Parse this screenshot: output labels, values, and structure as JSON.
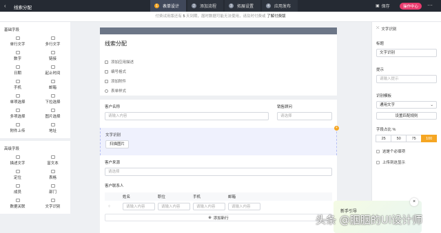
{
  "topbar": {
    "back": "‹",
    "title": "线索分配",
    "steps": [
      {
        "num": "1",
        "label": "表单设计"
      },
      {
        "num": "2",
        "label": "添加流程"
      },
      {
        "num": "3",
        "label": "拓展设置"
      },
      {
        "num": "4",
        "label": "应用发布"
      }
    ],
    "save": "保存",
    "upgrade": "操作中心",
    "more": "⋯"
  },
  "notice": {
    "pre": "付费试用版还有",
    "days": "5",
    "mid": "天到期，届时数据可能无法使用，请及时付费或",
    "link": "了解付费版"
  },
  "left": {
    "basic_title": "基础字段",
    "basic": [
      "单行文字",
      "多行文字",
      "数字",
      "链接",
      "日期",
      "起止时间",
      "手机",
      "邮箱",
      "单项选择",
      "下拉选择",
      "多项选择",
      "图片选择",
      "附件上传",
      "地址"
    ],
    "advanced_title": "高级字段",
    "advanced": [
      "描述文字",
      "富文本",
      "定位",
      "表格",
      "成员",
      "部门",
      "数据关联",
      "文字识别"
    ]
  },
  "form": {
    "title": "线索分配",
    "options": [
      "添加应用描述",
      "编号格式",
      "添加附件",
      "表单样式"
    ],
    "customer_name": {
      "label": "客户名称",
      "placeholder": "请输入内容"
    },
    "sales": {
      "label": "销售顾问",
      "placeholder": "请选择"
    },
    "ocr": {
      "label": "文字识别",
      "button": "扫描图片"
    },
    "source": {
      "label": "客户来源",
      "placeholder": "请选择"
    },
    "contacts": {
      "label": "客户联系人",
      "columns": [
        "姓名",
        "职位",
        "手机",
        "邮箱"
      ],
      "placeholders": [
        "请输入内容",
        "请输入内容",
        "请输入内容",
        "请输入内容"
      ],
      "add": "添加新行"
    }
  },
  "right": {
    "header": "文字识别",
    "title_label": "标题",
    "title_value": "文字识别",
    "hint_label": "提示",
    "hint_placeholder": "请输入提示",
    "template_label": "识别模板",
    "template_value": "通用文字",
    "config_button": "设置匹配规则",
    "width_label": "字段占比 %",
    "widths": [
      "25",
      "50",
      "75",
      "100"
    ],
    "required": "这是个必填项",
    "upload_show": "上传到这显示"
  },
  "guide": {
    "title": "新手引导",
    "close": "×"
  },
  "watermark": "头条 @胭胭的UI设计师",
  "colors": {
    "accent": "#f5a623",
    "topbar": "#252a33",
    "upgrade": "#e83c6f"
  }
}
